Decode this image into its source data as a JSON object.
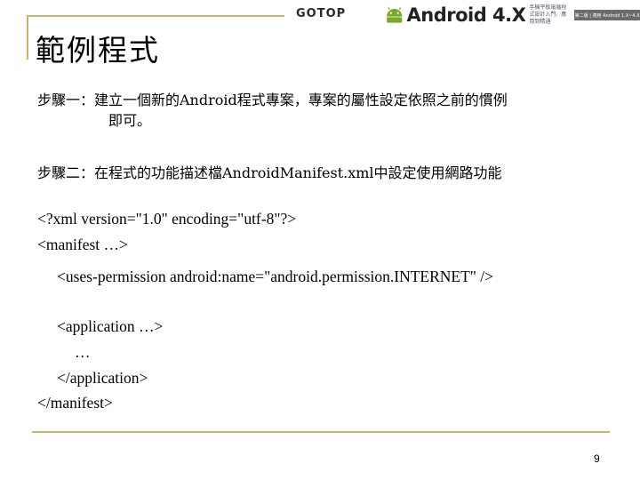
{
  "header": {
    "title": "範例程式",
    "publisher": "GOTOP",
    "book_title_main": "Android 4.X",
    "book_subtitle": "手機平板電腦程式設計入門、應用到精通",
    "book_box": "第二版 | 適用 Android 1.X~4.X"
  },
  "steps": [
    {
      "line1": "步驟一：建立一個新的Android程式專案，專案的屬性設定依照之前的慣例",
      "line2": "即可。"
    },
    {
      "line1": "步驟二：在程式的功能描述檔AndroidManifest.xml中設定使用網路功能"
    }
  ],
  "code": {
    "line1": "<?xml version=\"1.0\" encoding=\"utf-8\"?>",
    "line2": "<manifest …>",
    "line3": "<uses-permission android:name=\"android.permission.INTERNET\" />",
    "line4": "<application …>",
    "line5": "…",
    "line6": "</application>",
    "line7": "</manifest>"
  },
  "footer": {
    "page_number": "9"
  },
  "colors": {
    "accent_line": "#c8b46a",
    "android_green": "#7aa82a"
  }
}
